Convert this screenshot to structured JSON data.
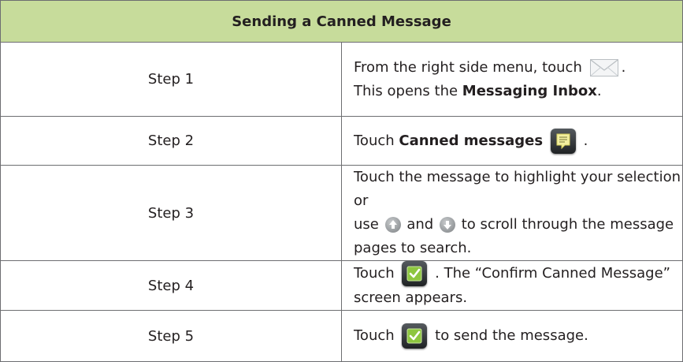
{
  "title": "Sending a Canned Message",
  "icons": {
    "envelope": "envelope-icon",
    "canned": "canned-messages-icon",
    "up": "scroll-up-arrow-icon",
    "down": "scroll-down-arrow-icon",
    "confirm": "confirm-checkmark-icon"
  },
  "colors": {
    "header_bg": "#c7dc9b",
    "border": "#6d6e71",
    "check_green": "#8dc63f"
  },
  "steps": [
    {
      "label": "Step 1",
      "line1_a": "From the right side menu, touch",
      "line1_b": ".",
      "line2_a": "This opens the ",
      "line2_bold": "Messaging Inbox",
      "line2_b": "."
    },
    {
      "label": "Step 2",
      "a": "Touch ",
      "bold": "Canned messages",
      "b": "."
    },
    {
      "label": "Step 3",
      "line1": "Touch the message to highlight your selection or",
      "line2_a": "use",
      "line2_b": "and",
      "line2_c": "to scroll through the message pages to search."
    },
    {
      "label": "Step 4",
      "a": "Touch",
      "b": ". The “Confirm Canned Message” screen appears."
    },
    {
      "label": "Step 5",
      "a": "Touch",
      "b": "to send the message."
    }
  ]
}
